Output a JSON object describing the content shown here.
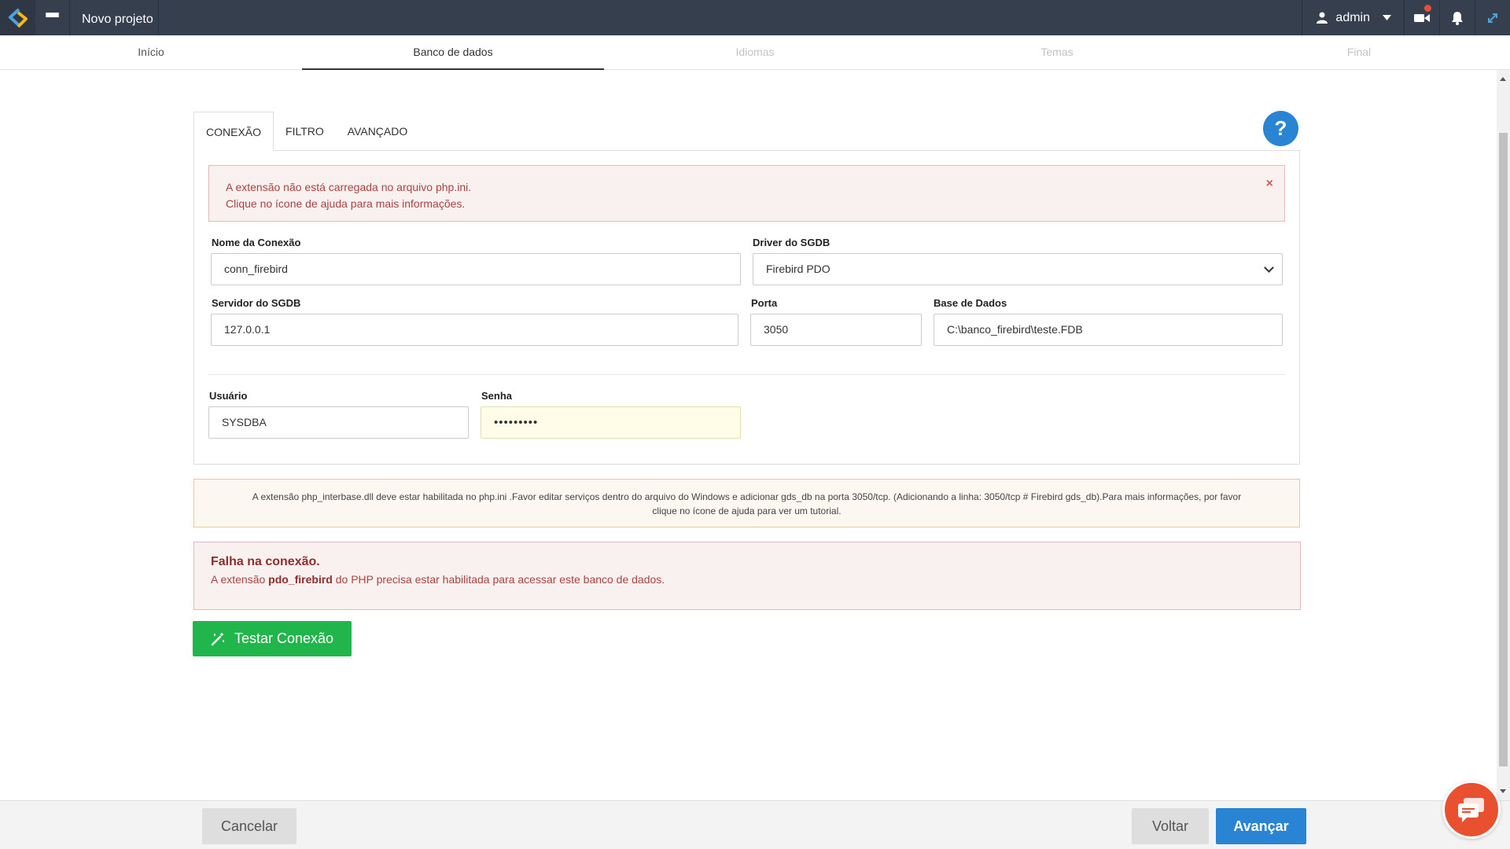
{
  "header": {
    "project_title": "Novo projeto",
    "user_name": "admin",
    "logo_icon": "scriptcase-logo-icon",
    "colors": {
      "bar": "#363f4e",
      "accent_blue": "#2a84d4",
      "success_green": "#21b64b",
      "error_red": "#a94442"
    }
  },
  "steps": [
    {
      "label": "Início",
      "state": "done"
    },
    {
      "label": "Banco de dados",
      "state": "active"
    },
    {
      "label": "Idiomas",
      "state": "disabled"
    },
    {
      "label": "Temas",
      "state": "disabled"
    },
    {
      "label": "Final",
      "state": "disabled"
    }
  ],
  "tabs": [
    {
      "label": "CONEXÃO",
      "active": true
    },
    {
      "label": "FILTRO",
      "active": false
    },
    {
      "label": "AVANÇADO",
      "active": false
    }
  ],
  "help_label": "?",
  "alert": {
    "line1": "A extensão não está carregada no arquivo php.ini.",
    "line2": "Clique no ícone de ajuda para mais informações.",
    "close": "×"
  },
  "form": {
    "connection_name": {
      "label": "Nome da Conexão",
      "value": "conn_firebird"
    },
    "driver": {
      "label": "Driver do SGDB",
      "value": "Firebird PDO"
    },
    "server": {
      "label": "Servidor do SGDB",
      "value": "127.0.0.1"
    },
    "port": {
      "label": "Porta",
      "value": "3050"
    },
    "database": {
      "label": "Base de Dados",
      "value": "C:\\banco_firebird\\teste.FDB"
    },
    "user": {
      "label": "Usuário",
      "value": "SYSDBA"
    },
    "password": {
      "label": "Senha",
      "value": "•••••••••"
    }
  },
  "note": {
    "line1": "A extensão php_interbase.dll deve estar habilitada no php.ini .Favor editar serviços dentro do arquivo do Windows e adicionar gds_db na porta 3050/tcp. (Adicionando a linha: 3050/tcp # Firebird gds_db).Para mais informações, por favor",
    "line2": "clique no ícone de ajuda para ver um tutorial."
  },
  "failure": {
    "title": "Falha na conexão.",
    "prefix": "A extensão",
    "ext": "pdo_firebird",
    "suffix": "do PHP precisa estar habilitada para acessar este banco de dados."
  },
  "test_button": "Testar Conexão",
  "footer": {
    "cancel": "Cancelar",
    "back": "Voltar",
    "next": "Avançar"
  }
}
